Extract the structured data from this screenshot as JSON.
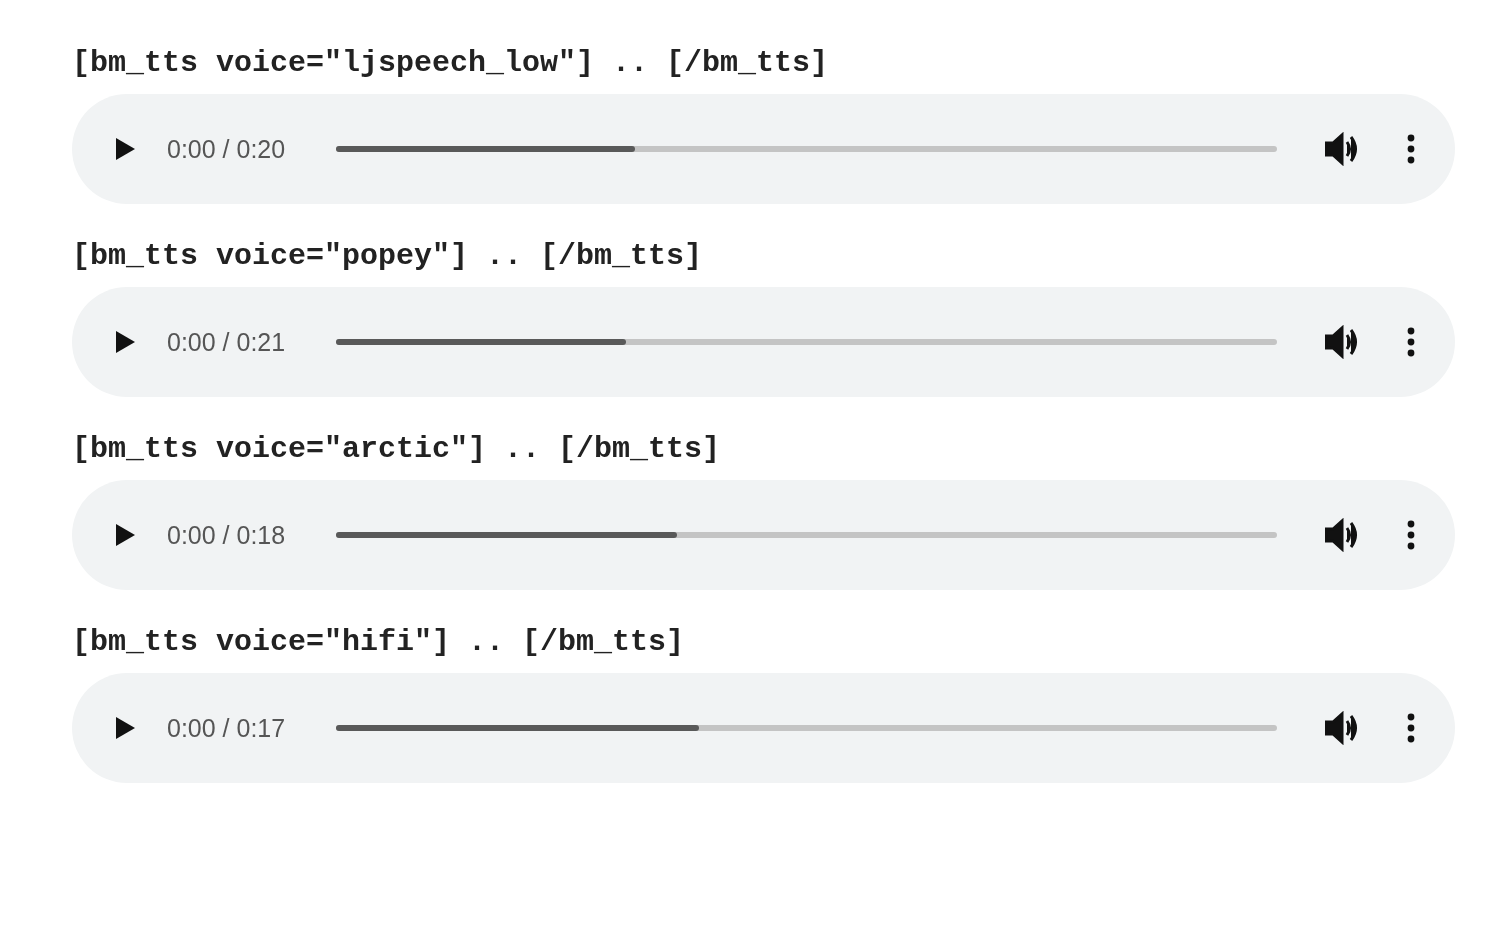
{
  "players": [
    {
      "label": "[bm_tts voice=\"ljspeech_low\"] .. [/bm_tts]",
      "time": "0:00 / 0:20",
      "level": 0.318
    },
    {
      "label": "[bm_tts voice=\"popey\"] .. [/bm_tts]",
      "time": "0:00 / 0:21",
      "level": 0.308
    },
    {
      "label": "[bm_tts voice=\"arctic\"] .. [/bm_tts]",
      "time": "0:00 / 0:18",
      "level": 0.362
    },
    {
      "label": "[bm_tts voice=\"hifi\"] .. [/bm_tts]",
      "time": "0:00 / 0:17",
      "level": 0.386
    }
  ]
}
